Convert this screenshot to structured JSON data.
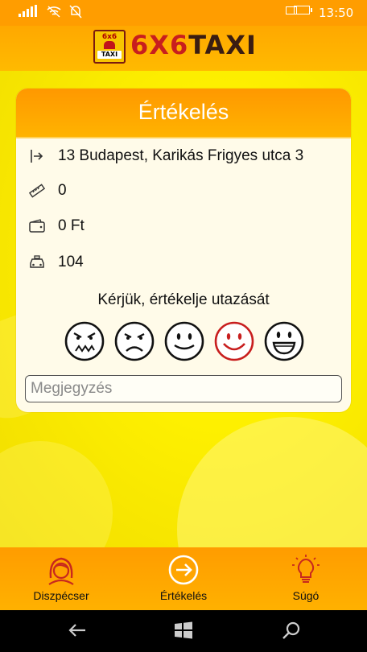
{
  "status_bar": {
    "time": "13:50"
  },
  "header": {
    "logo_text_a": "6X6",
    "logo_text_b": "TAXI",
    "badge_top": "6x6",
    "badge_bottom": "TAXI"
  },
  "card": {
    "title": "Értékelés",
    "address": "13 Budapest, Karikás Frigyes utca 3",
    "distance": "0",
    "price": "0 Ft",
    "taxi_number": "104",
    "prompt": "Kérjük, értékelje utazását",
    "comment_placeholder": "Megjegyzés",
    "ratings": [
      "very-bad",
      "bad",
      "neutral",
      "good",
      "very-good"
    ],
    "selected_rating": "good",
    "selected_color": "#c81e1e"
  },
  "appbar": {
    "items": [
      {
        "label": "Diszpécser",
        "icon": "dispatcher-icon"
      },
      {
        "label": "Értékelés",
        "icon": "arrow-circle-icon"
      },
      {
        "label": "Súgó",
        "icon": "lightbulb-icon"
      }
    ]
  },
  "colors": {
    "accent": "#ff9d00",
    "card_bg": "#fffbe9",
    "background": "#ffe600"
  }
}
